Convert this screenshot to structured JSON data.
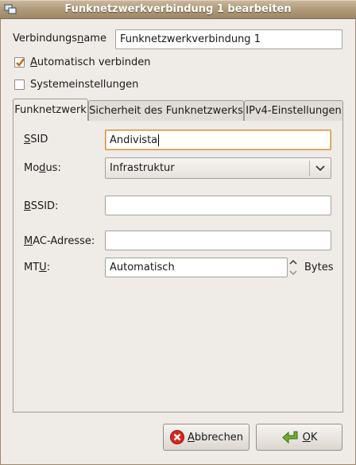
{
  "window": {
    "title": "Funknetzwerkverbindung 1 bearbeiten",
    "icon": "network-window-icon"
  },
  "connection_name": {
    "label_pre": "Verbindungs",
    "label_ul": "n",
    "label_post": "ame",
    "value": "Funknetzwerkverbindung 1"
  },
  "auto_connect": {
    "label_ul": "A",
    "label_post": "utomatisch verbinden",
    "checked": true
  },
  "system_settings": {
    "label": "Systemeinstellungen",
    "checked": false
  },
  "tabs": [
    {
      "label": "Funknetzwerk",
      "active": true
    },
    {
      "label": "Sicherheit des Funknetzwerks",
      "active": false
    },
    {
      "label": "IPv4-Einstellungen",
      "active": false
    }
  ],
  "wireless": {
    "ssid_label_ul": "S",
    "ssid_label_post": "SID",
    "ssid_value": "Andivista",
    "mode_label_pre": "Mo",
    "mode_label_ul": "d",
    "mode_label_post": "us:",
    "mode_value": "Infrastruktur",
    "bssid_label_ul": "B",
    "bssid_label_post": "SSID:",
    "bssid_value": "",
    "mac_label_pre": "",
    "mac_label_ul": "M",
    "mac_label_post": "AC-Adresse:",
    "mac_value": "",
    "mtu_label_pre": "MT",
    "mtu_label_ul": "U",
    "mtu_label_post": ":",
    "mtu_value": "Automatisch",
    "mtu_unit": "Bytes"
  },
  "buttons": {
    "cancel_ul": "A",
    "cancel_post": "bbrechen",
    "ok_ul": "O",
    "ok_post": "K"
  },
  "colors": {
    "titlebar": "#ad9877",
    "focus": "#d98c3b",
    "check_mark": "#c46a12",
    "cancel_icon": "#d8261c",
    "ok_icon": "#6fae2b"
  }
}
